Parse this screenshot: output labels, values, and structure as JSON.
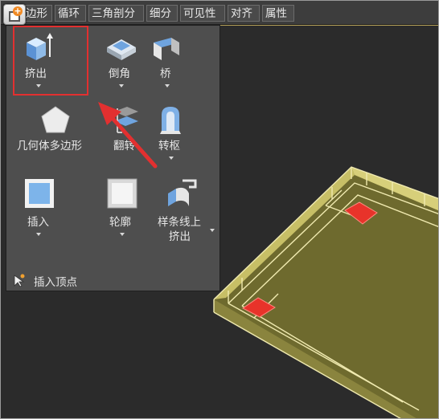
{
  "menu": {
    "tabs": [
      "边形",
      "循环",
      "三角剖分",
      "细分",
      "可见性",
      "对齐",
      "属性"
    ]
  },
  "tools": {
    "extrude": "挤出",
    "bevel": "倒角",
    "bridge": "桥",
    "geo_poly": "几何体多边形",
    "flip": "翻转",
    "hinge": "转枢",
    "inset": "插入",
    "outline": "轮廓",
    "extrude_spline_l1": "样条线上",
    "extrude_spline_l2": "挤出",
    "insert_vertex": "插入顶点"
  },
  "colors": {
    "highlight_box": "#e23030",
    "arrow": "#e23030",
    "model_face": "#6e6a2e",
    "model_rim": "#e3dc93",
    "selected_face": "#e8332a",
    "viewport": "#2b2b2b",
    "panel": "#4e4e4e"
  }
}
